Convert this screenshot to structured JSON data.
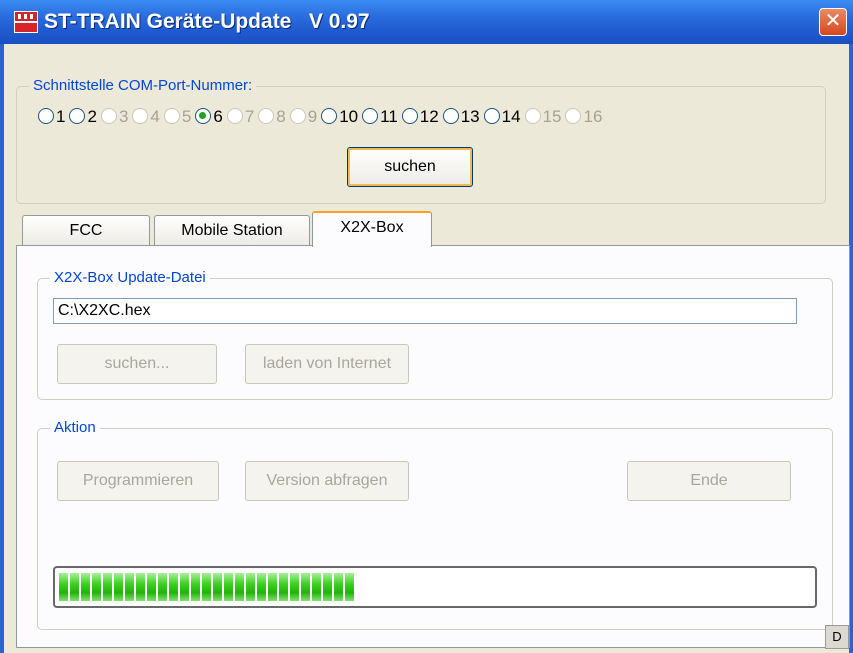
{
  "window": {
    "title": "ST-TRAIN Geräte-Update   V 0.97",
    "close_symbol": "✕"
  },
  "com_group": {
    "legend": "Schnittstelle COM-Port-Nummer:",
    "ports": [
      {
        "label": "1",
        "enabled": true,
        "checked": false
      },
      {
        "label": "2",
        "enabled": true,
        "checked": false
      },
      {
        "label": "3",
        "enabled": false,
        "checked": false
      },
      {
        "label": "4",
        "enabled": false,
        "checked": false
      },
      {
        "label": "5",
        "enabled": false,
        "checked": false
      },
      {
        "label": "6",
        "enabled": true,
        "checked": true
      },
      {
        "label": "7",
        "enabled": false,
        "checked": false
      },
      {
        "label": "8",
        "enabled": false,
        "checked": false
      },
      {
        "label": "9",
        "enabled": false,
        "checked": false
      },
      {
        "label": "10",
        "enabled": true,
        "checked": false
      },
      {
        "label": "11",
        "enabled": true,
        "checked": false
      },
      {
        "label": "12",
        "enabled": true,
        "checked": false
      },
      {
        "label": "13",
        "enabled": true,
        "checked": false
      },
      {
        "label": "14",
        "enabled": true,
        "checked": false
      },
      {
        "label": "15",
        "enabled": false,
        "checked": false
      },
      {
        "label": "16",
        "enabled": false,
        "checked": false
      }
    ],
    "search_button": "suchen"
  },
  "tabs": [
    {
      "label": "FCC",
      "active": false
    },
    {
      "label": "Mobile Station",
      "active": false
    },
    {
      "label": "X2X-Box",
      "active": true
    }
  ],
  "update_group": {
    "legend": "X2X-Box Update-Datei",
    "file_path": "C:\\X2XC.hex",
    "browse_button": "suchen...",
    "internet_button": "laden von Internet"
  },
  "action_group": {
    "legend": "Aktion",
    "program_button": "Programmieren",
    "version_button": "Version abfragen",
    "end_button": "Ende"
  },
  "progress": {
    "value_fraction": 0.39,
    "color": "#2cc414"
  },
  "scroll_stub_label": "D",
  "colors": {
    "titlebar": "#2a6ee0",
    "legend_text": "#0046d5",
    "window_bg": "#ece9d8"
  }
}
